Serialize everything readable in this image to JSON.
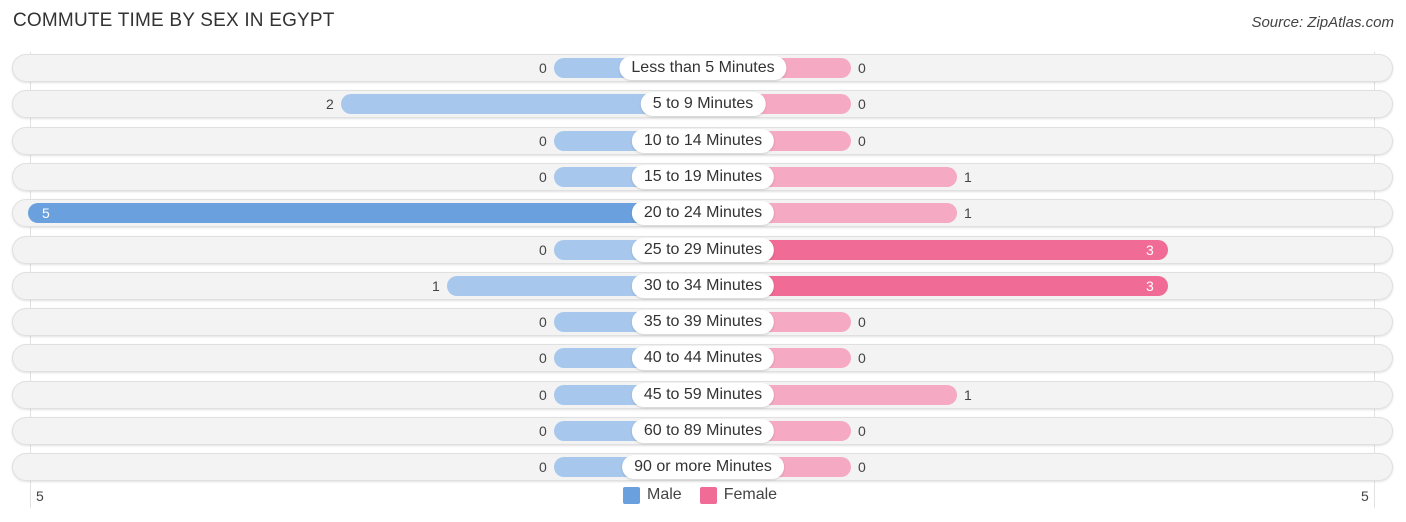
{
  "chart_data": {
    "type": "bar",
    "orientation": "diverging-horizontal",
    "title": "COMMUTE TIME BY SEX IN EGYPT",
    "source": "Source: ZipAtlas.com",
    "categories": [
      "Less than 5 Minutes",
      "5 to 9 Minutes",
      "10 to 14 Minutes",
      "15 to 19 Minutes",
      "20 to 24 Minutes",
      "25 to 29 Minutes",
      "30 to 34 Minutes",
      "35 to 39 Minutes",
      "40 to 44 Minutes",
      "45 to 59 Minutes",
      "60 to 89 Minutes",
      "90 or more Minutes"
    ],
    "series": [
      {
        "name": "Male",
        "color": "#6aa0de",
        "light_color": "#a8c7ec",
        "values": [
          0,
          2,
          0,
          0,
          5,
          0,
          1,
          0,
          0,
          0,
          0,
          0
        ]
      },
      {
        "name": "Female",
        "color": "#f06b95",
        "light_color": "#f6a9c2",
        "values": [
          0,
          0,
          0,
          1,
          1,
          3,
          3,
          0,
          0,
          1,
          0,
          0
        ]
      }
    ],
    "axis": {
      "left_label": "5",
      "right_label": "5",
      "max": 5
    },
    "legend": {
      "position": "bottom-center",
      "entries": [
        "Male",
        "Female"
      ]
    },
    "grid": false
  }
}
